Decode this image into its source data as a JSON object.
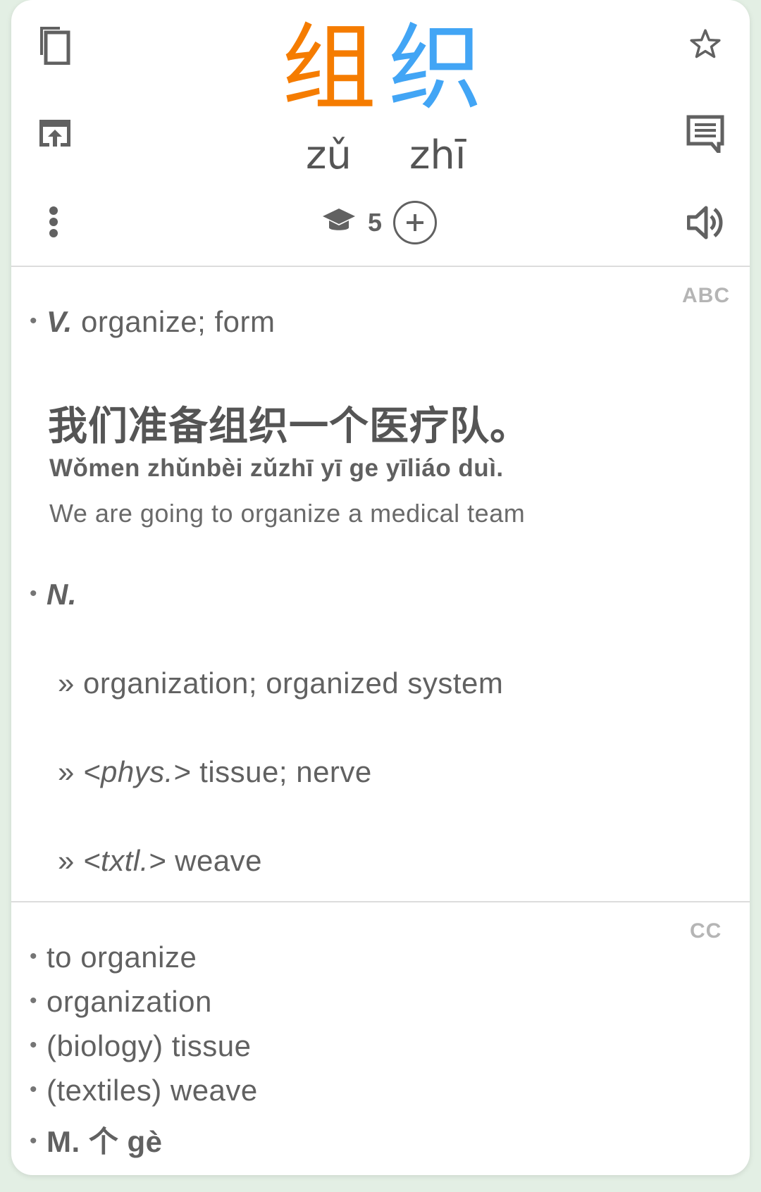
{
  "word": {
    "chars": [
      {
        "hanzi": "组",
        "pinyin": "zǔ",
        "color": "#f57c00"
      },
      {
        "hanzi": "织",
        "pinyin": "zhī",
        "color": "#42a5f5"
      }
    ]
  },
  "hsk": {
    "level": "5"
  },
  "icons": {
    "copy": "copy-icon",
    "open": "open-external-icon",
    "more": "more-vert-icon",
    "star": "star-outline-icon",
    "comment": "comment-icon",
    "speaker": "speaker-icon",
    "hsk": "graduation-cap-icon",
    "add": "add-circle-icon"
  },
  "abc": {
    "tag": "ABC",
    "v": {
      "pos": "V.",
      "def": "organize; form",
      "example": {
        "hanzi": "我们准备组织一个医疗队。",
        "pinyin": "Wǒmen zhǔnbèi zǔzhī yī ge yīliáo duì.",
        "english": "We are going to organize a medical team"
      }
    },
    "n": {
      "pos": "N.",
      "senses": [
        {
          "marker": "»",
          "domain": "",
          "text": "organization; organized system"
        },
        {
          "marker": "»",
          "domain": "<phys.>",
          "text": "tissue; nerve"
        },
        {
          "marker": "»",
          "domain": "<txtl.>",
          "text": "weave"
        }
      ]
    }
  },
  "cc": {
    "tag": "CC",
    "items": [
      "to organize",
      "organization",
      "(biology) tissue",
      "(textiles) weave"
    ],
    "measure": "M. 个 gè"
  },
  "colors": {
    "accent_zu": "#f57c00",
    "accent_zhi": "#42a5f5",
    "icon": "#616161"
  }
}
